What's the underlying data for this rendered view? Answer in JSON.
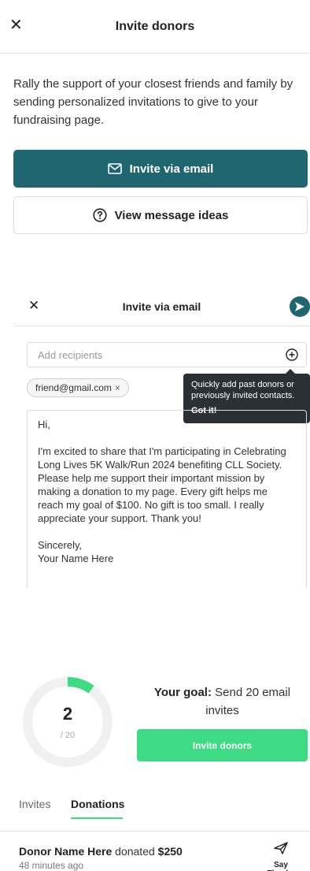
{
  "header": {
    "title": "Invite donors"
  },
  "intro": {
    "text": "Rally the support of your closest friends and family by sending personalized invitations to give to your fundraising page."
  },
  "actions": {
    "invite_email_label": "Invite via email",
    "message_ideas_label": "View message ideas"
  },
  "email_modal": {
    "title": "Invite via email",
    "recipients_placeholder": "Add recipients",
    "chip": "friend@gmail.com",
    "tooltip_text": "Quickly add past donors or previously invited contacts.",
    "tooltip_action": "Got it!",
    "message": {
      "greeting": "Hi,",
      "body": "I'm excited to share that I'm participating in Celebrating Long Lives 5K Walk/Run 2024 benefiting CLL Society. Please help me support their important mission by making a donation to my page. Every gift helps me reach my goal of $100. No gift is too small. I really appreciate your support. Thank you!",
      "closing": "Sincerely,",
      "signature": "Your Name Here"
    }
  },
  "goal": {
    "sent": "2",
    "total": "/ 20",
    "label_bold": "Your goal:",
    "label_text": "Send 20 email invites",
    "progress_fraction": 0.1,
    "button_label": "Invite donors"
  },
  "tabs": [
    {
      "label": "Invites"
    },
    {
      "label": "Donations"
    }
  ],
  "donation": {
    "name": "Donor Name Here",
    "verb": "donated",
    "amount": "$250",
    "time": "48 minutes ago",
    "action_label": "Say Thanks"
  },
  "colors": {
    "primary": "#1f6670",
    "accent": "#3ddc84"
  }
}
